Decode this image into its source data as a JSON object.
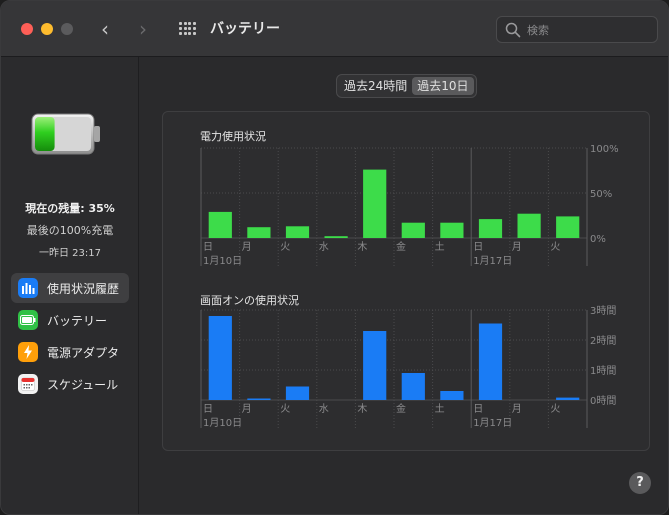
{
  "window": {
    "title": "バッテリー"
  },
  "search": {
    "placeholder": "検索"
  },
  "sidebar": {
    "battery_level": 35,
    "charge_status": "現在の残量: 35%",
    "last_full": "最後の100%充電",
    "last_full_time": "一昨日 23:17",
    "items": [
      {
        "label": "使用状況履歴",
        "icon": "bar-chart-icon",
        "color": "#1a7cf5",
        "active": true
      },
      {
        "label": "バッテリー",
        "icon": "battery-icon",
        "color": "#30c146",
        "active": false
      },
      {
        "label": "電源アダプタ",
        "icon": "bolt-icon",
        "color": "#ff9f0a",
        "active": false
      },
      {
        "label": "スケジュール",
        "icon": "calendar-icon",
        "color": "#f2f2f2",
        "active": false
      }
    ]
  },
  "segmented": {
    "options": [
      "過去24時間",
      "過去10日"
    ],
    "selected": 1
  },
  "colors": {
    "usage_bar": "#3ddc4a",
    "screen_bar": "#1a7cf5",
    "grid": "#4a4a4c",
    "label": "#8a8a8c"
  },
  "chart_data": [
    {
      "type": "bar",
      "title": "電力使用状況",
      "categories": [
        "日",
        "月",
        "火",
        "水",
        "木",
        "金",
        "土",
        "日",
        "月",
        "火"
      ],
      "date_labels": [
        {
          "index": 0,
          "text": "1月10日"
        },
        {
          "index": 7,
          "text": "1月17日"
        }
      ],
      "values": [
        29,
        12,
        13,
        2,
        76,
        17,
        17,
        21,
        27,
        24
      ],
      "ylim": [
        0,
        100
      ],
      "yticks": [
        {
          "value": 0,
          "label": "0%"
        },
        {
          "value": 50,
          "label": "50%"
        },
        {
          "value": 100,
          "label": "100%"
        }
      ],
      "color": "#3ddc4a"
    },
    {
      "type": "bar",
      "title": "画面オンの使用状況",
      "categories": [
        "日",
        "月",
        "火",
        "水",
        "木",
        "金",
        "土",
        "日",
        "月",
        "火"
      ],
      "date_labels": [
        {
          "index": 0,
          "text": "1月10日"
        },
        {
          "index": 7,
          "text": "1月17日"
        }
      ],
      "values": [
        2.8,
        0.05,
        0.45,
        0,
        2.3,
        0.9,
        0.3,
        2.55,
        0,
        0.08
      ],
      "ylim": [
        0,
        3
      ],
      "yticks": [
        {
          "value": 0,
          "label": "0時間"
        },
        {
          "value": 1,
          "label": "1時間"
        },
        {
          "value": 2,
          "label": "2時間"
        },
        {
          "value": 3,
          "label": "3時間"
        }
      ],
      "color": "#1a7cf5"
    }
  ]
}
